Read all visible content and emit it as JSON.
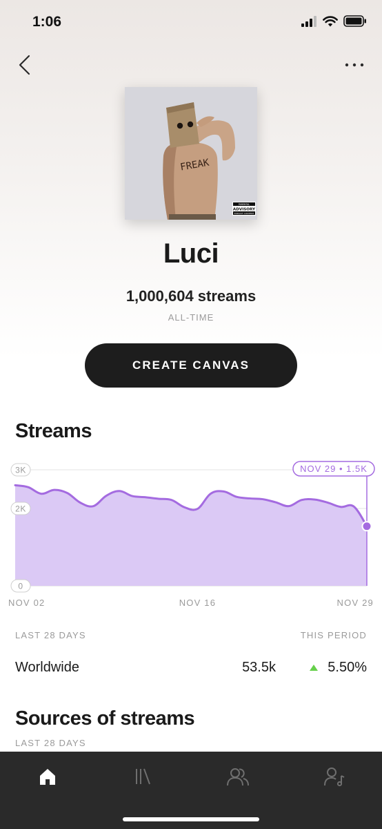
{
  "status_bar": {
    "time": "1:06"
  },
  "header": {
    "back_icon": "chevron-left-icon",
    "more_icon": "more-horizontal-icon"
  },
  "album_art": {
    "badge_lines": [
      "PARENTAL",
      "ADVISORY",
      "EXPLICIT CONTENT"
    ],
    "scribble": "FREAK"
  },
  "song": {
    "title": "Luci",
    "streams": "1,000,604 streams",
    "period": "ALL-TIME"
  },
  "cta": {
    "label": "CREATE CANVAS"
  },
  "streams_section": {
    "title": "Streams",
    "tooltip": "NOV 29 • 1.5K"
  },
  "chart_data": {
    "type": "area",
    "color": "#a46be0",
    "fill": "#dbc9f5",
    "y_ticks": [
      "3K",
      "2K",
      "0"
    ],
    "y_tick_values": [
      3000,
      2000,
      0
    ],
    "ylim": [
      0,
      3000
    ],
    "x_tick_labels": [
      "NOV 02",
      "NOV 16",
      "NOV 29"
    ],
    "x": [
      "NOV 02",
      "NOV 03",
      "NOV 04",
      "NOV 05",
      "NOV 06",
      "NOV 07",
      "NOV 08",
      "NOV 09",
      "NOV 10",
      "NOV 11",
      "NOV 12",
      "NOV 13",
      "NOV 14",
      "NOV 15",
      "NOV 16",
      "NOV 17",
      "NOV 18",
      "NOV 19",
      "NOV 20",
      "NOV 21",
      "NOV 22",
      "NOV 23",
      "NOV 24",
      "NOV 25",
      "NOV 26",
      "NOV 27",
      "NOV 28",
      "NOV 29"
    ],
    "values": [
      2600,
      2550,
      2380,
      2480,
      2400,
      2150,
      2060,
      2330,
      2450,
      2320,
      2290,
      2250,
      2220,
      2030,
      1990,
      2380,
      2440,
      2300,
      2260,
      2240,
      2160,
      2060,
      2220,
      2230,
      2150,
      2040,
      2050,
      1540
    ],
    "grid": true
  },
  "summary": {
    "left_caption": "LAST 28 DAYS",
    "right_caption": "THIS PERIOD",
    "row": {
      "label": "Worldwide",
      "value": "53.5k",
      "change": "5.50%",
      "trend": "up"
    }
  },
  "sources_section": {
    "title": "Sources of streams",
    "caption": "LAST 28 DAYS"
  },
  "tabbar": {
    "items": [
      {
        "name": "home",
        "icon": "home-icon",
        "active": true
      },
      {
        "name": "library",
        "icon": "library-icon",
        "active": false
      },
      {
        "name": "audience",
        "icon": "people-icon",
        "active": false
      },
      {
        "name": "profile",
        "icon": "artist-icon",
        "active": false
      }
    ]
  }
}
